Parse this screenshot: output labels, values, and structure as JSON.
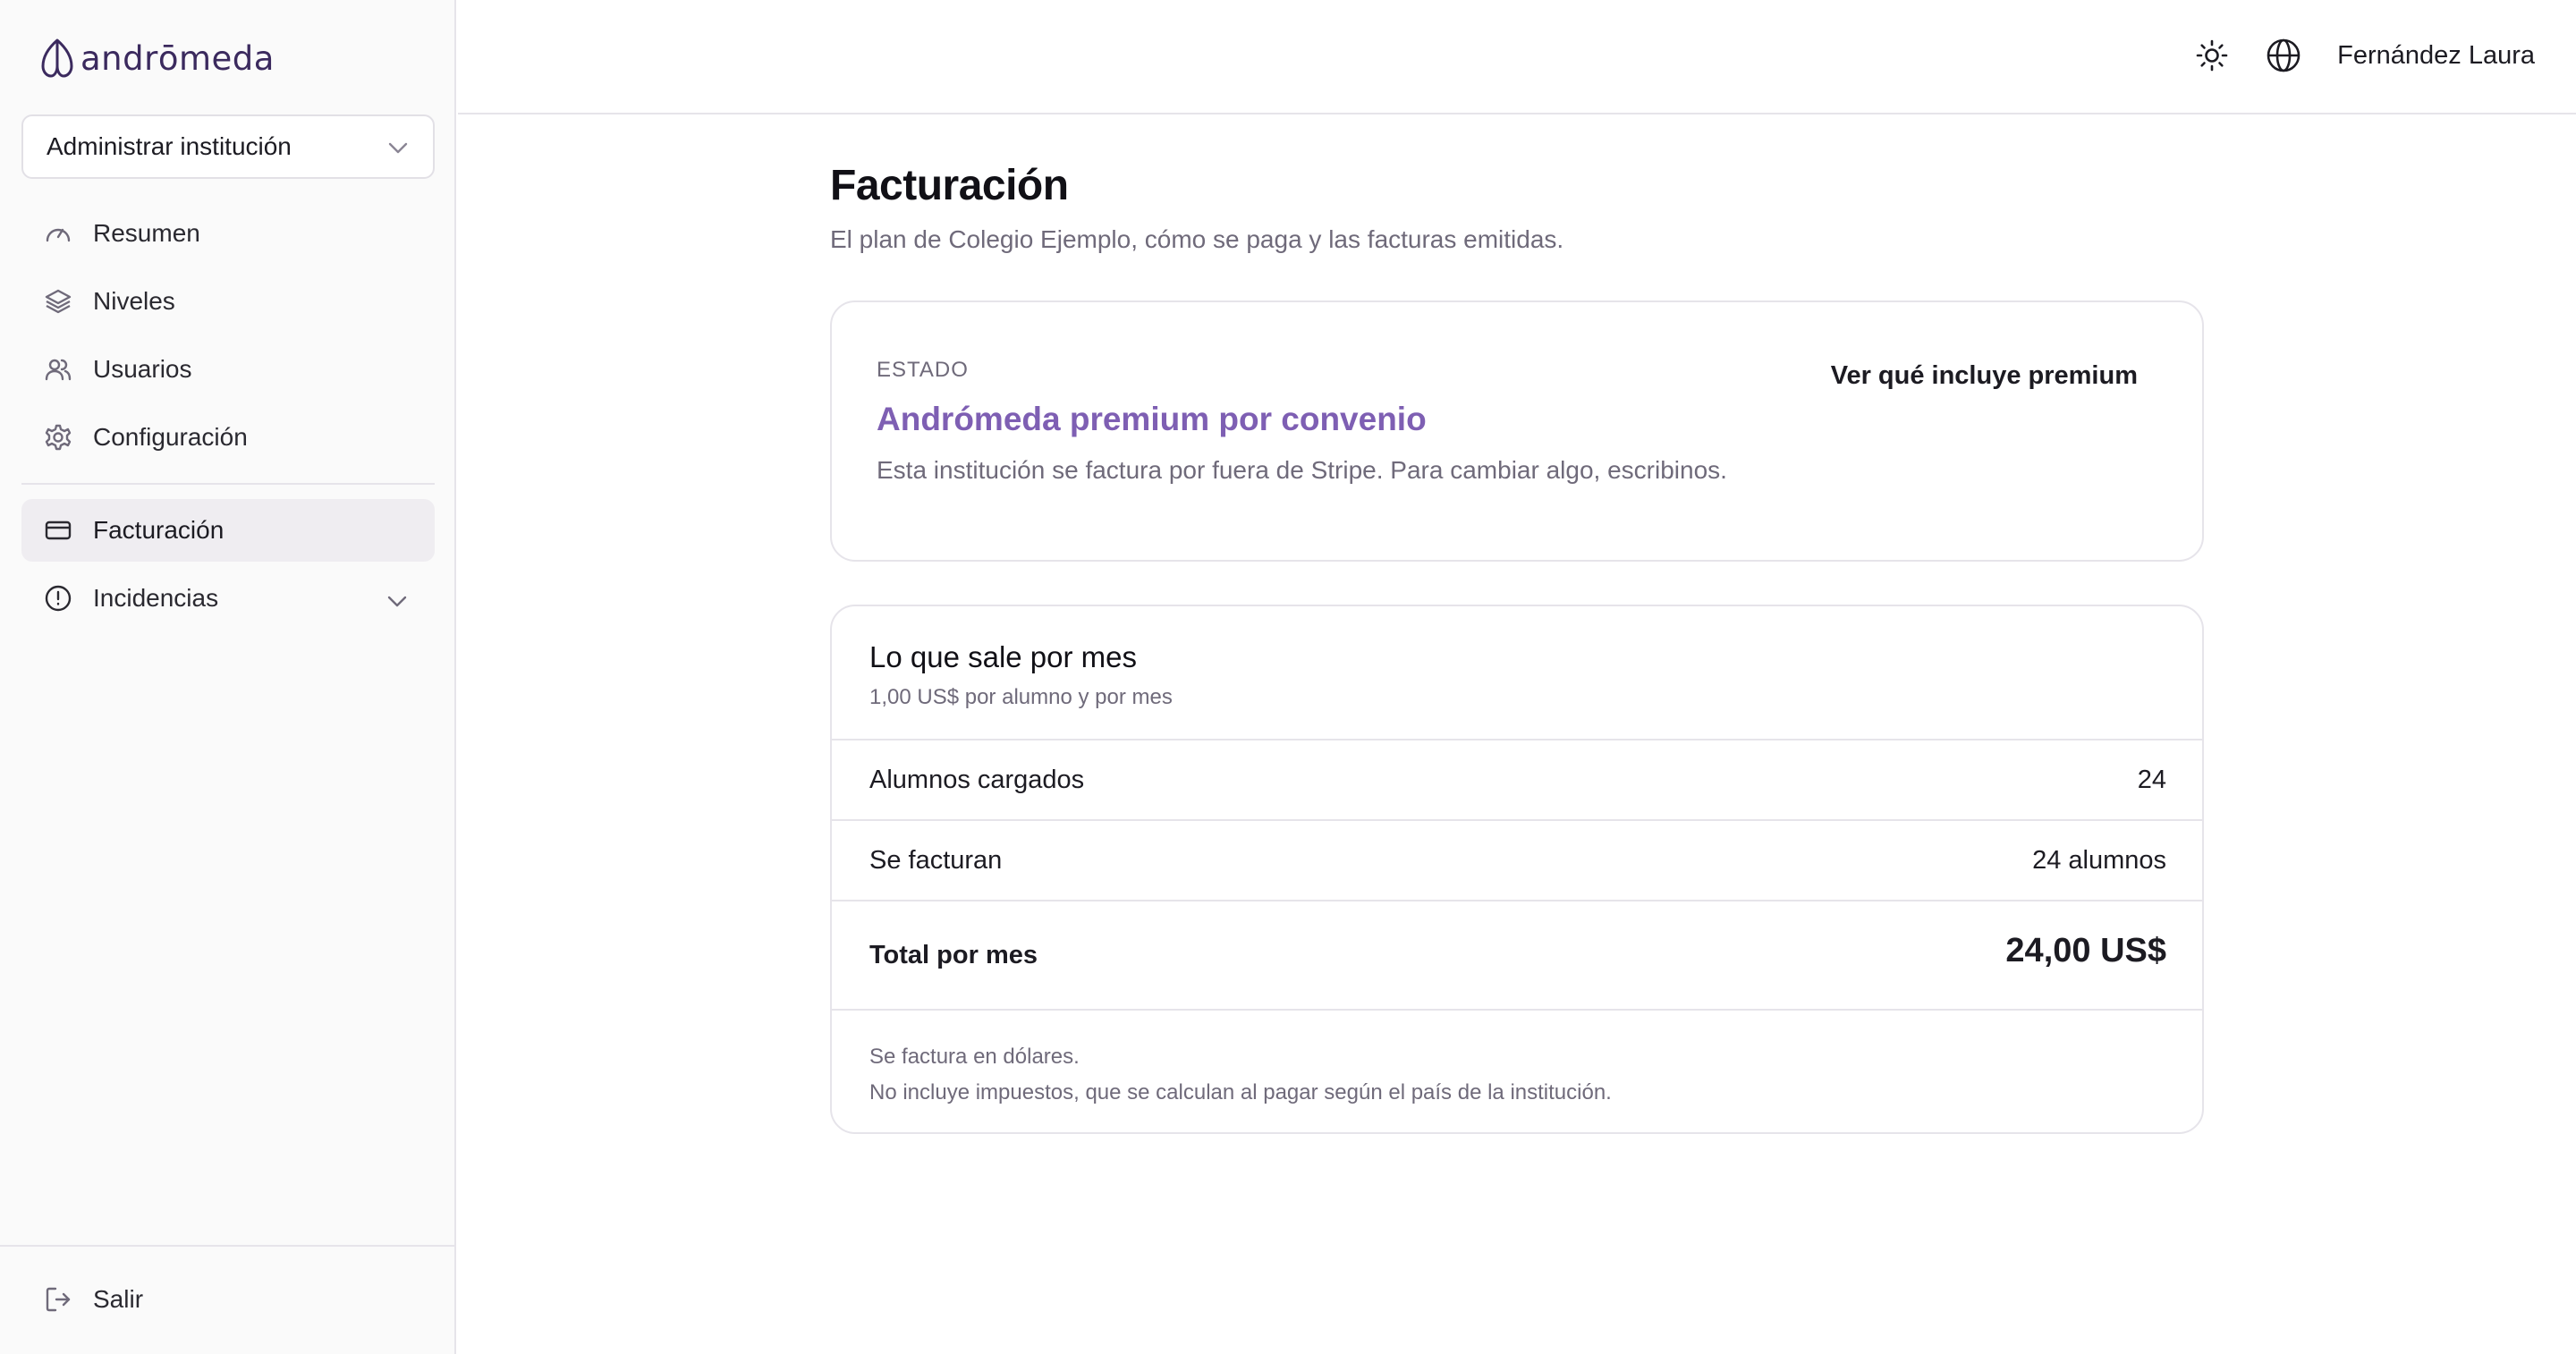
{
  "brand": {
    "name": "andrōmeda"
  },
  "sidebar": {
    "institution_select": "Administrar institución",
    "items": [
      {
        "label": "Resumen",
        "icon": "gauge-icon"
      },
      {
        "label": "Niveles",
        "icon": "layers-icon"
      },
      {
        "label": "Usuarios",
        "icon": "users-icon"
      },
      {
        "label": "Configuración",
        "icon": "gear-icon"
      }
    ],
    "secondary_items": [
      {
        "label": "Facturación",
        "icon": "credit-card-icon",
        "active": true
      },
      {
        "label": "Incidencias",
        "icon": "alert-circle-icon",
        "expandable": true
      }
    ],
    "logout_label": "Salir"
  },
  "header": {
    "user_name": "Fernández Laura"
  },
  "page": {
    "title": "Facturación",
    "subtitle": "El plan de Colegio Ejemplo, cómo se paga y las facturas emitidas."
  },
  "status_card": {
    "label": "ESTADO",
    "plan": "Andrómeda premium por convenio",
    "description": "Esta institución se factura por fuera de Stripe. Para cambiar algo, escribinos.",
    "link": "Ver qué incluye premium"
  },
  "pricing_card": {
    "title": "Lo que sale por mes",
    "subtitle": "1,00 US$ por alumno y por mes",
    "rows": [
      {
        "label": "Alumnos cargados",
        "value": "24"
      },
      {
        "label": "Se facturan",
        "value": "24 alumnos"
      },
      {
        "label": "Total por mes",
        "value": "24,00 US$"
      }
    ],
    "notes": [
      "Se factura en dólares.",
      "No incluye impuestos, que se calculan al pagar según el país de la institución."
    ]
  },
  "colors": {
    "accent": "#7e5fb3",
    "brand": "#3b2a5e",
    "muted_text": "#6f6a7a",
    "border": "#e6e4ea",
    "sidebar_bg": "#fafafa",
    "active_item_bg": "#efedf1"
  }
}
